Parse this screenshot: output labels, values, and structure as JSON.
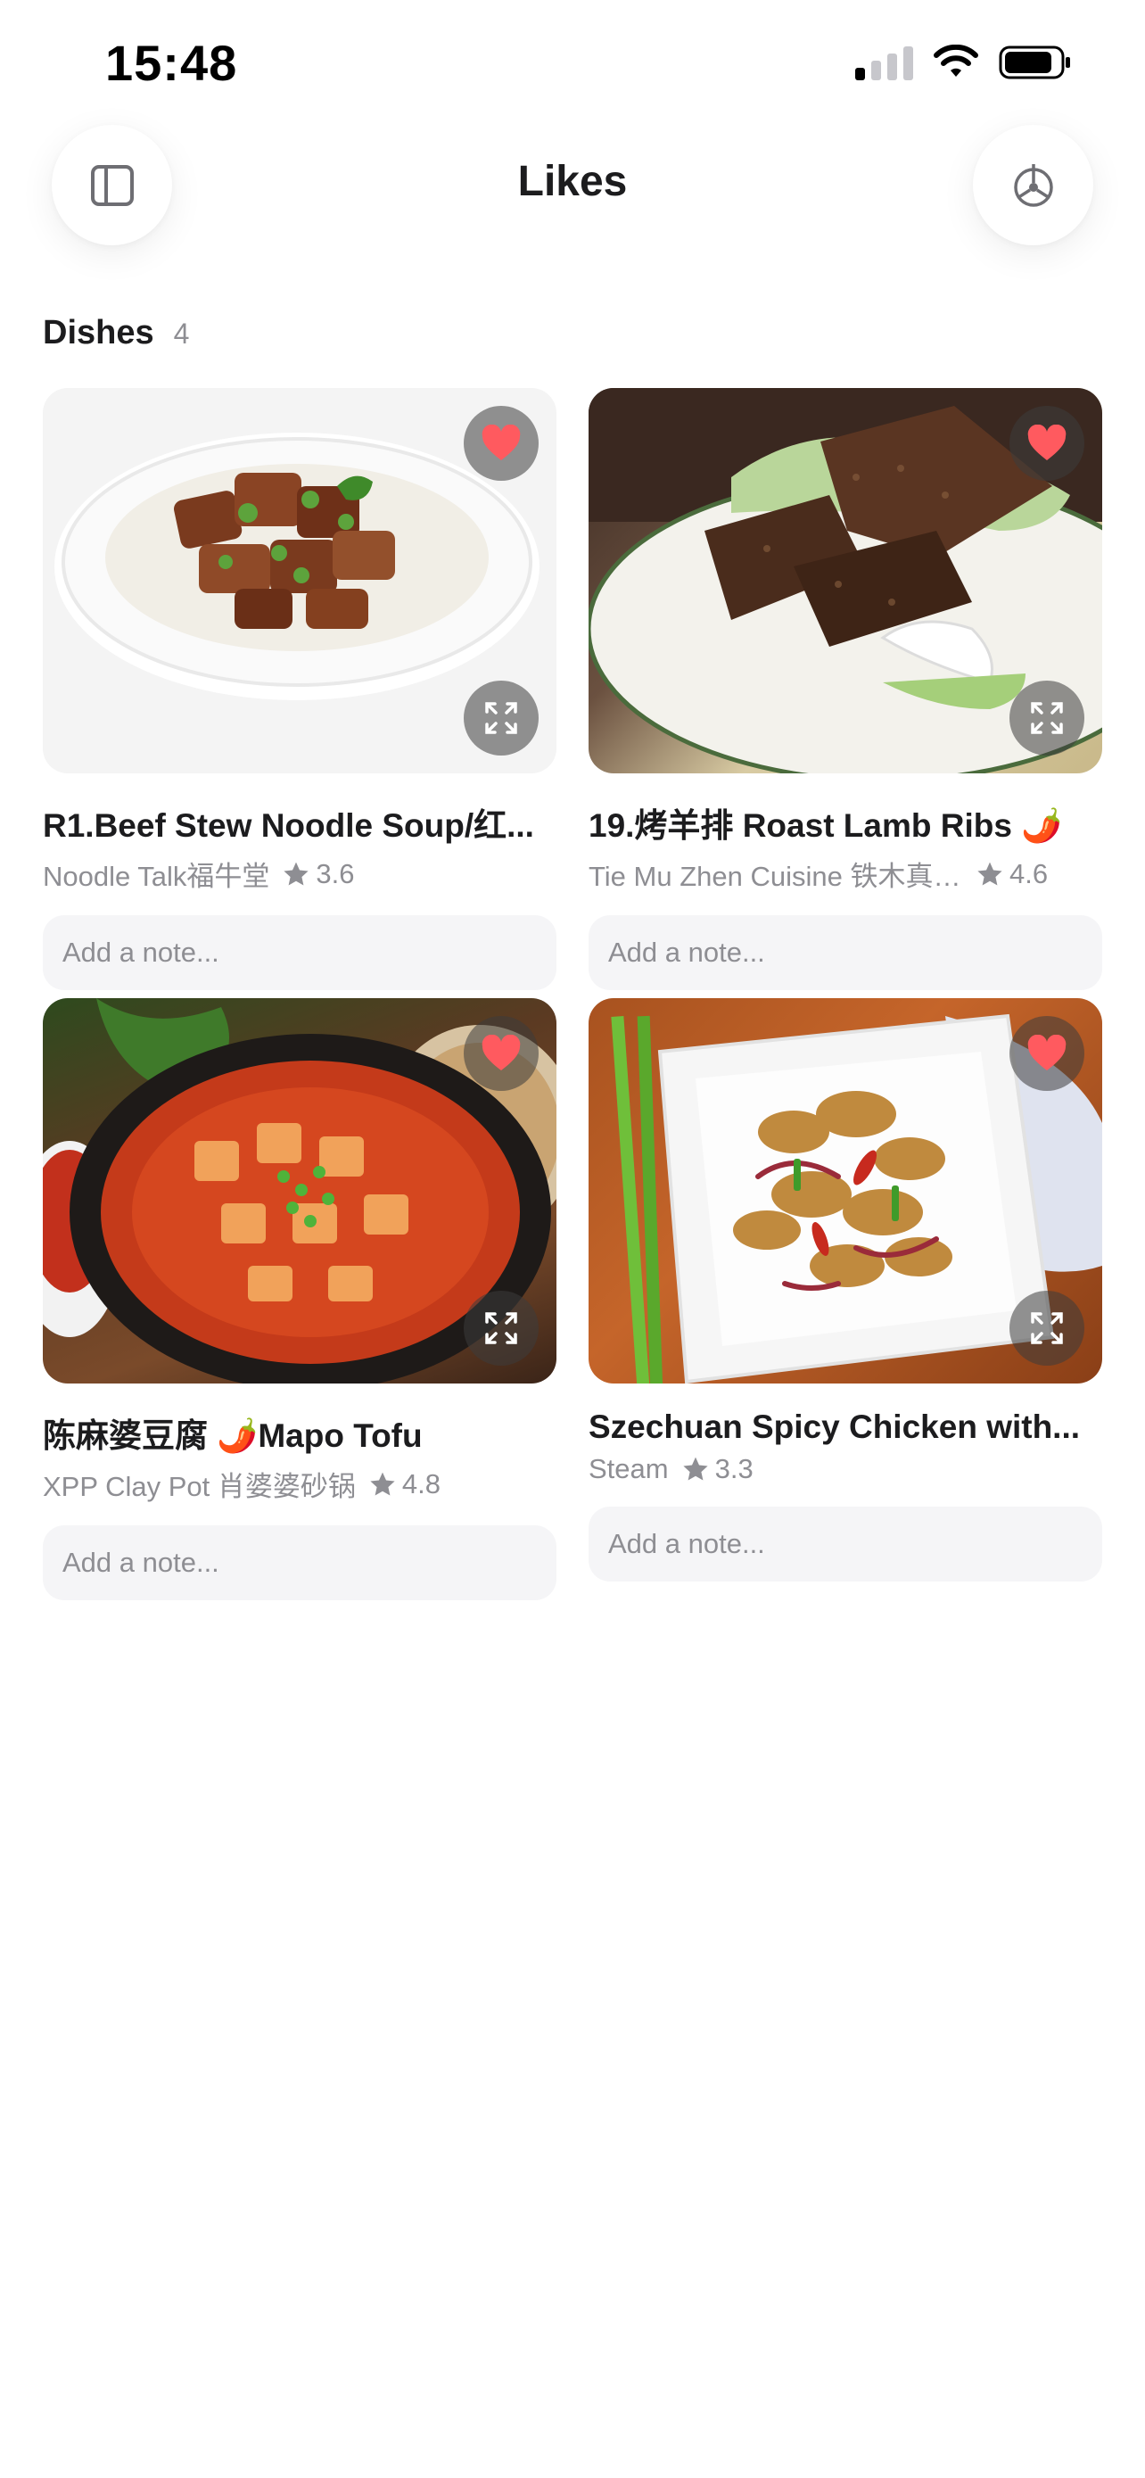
{
  "status_bar": {
    "time": "15:48"
  },
  "header": {
    "title": "Likes",
    "left_icon": "sidebar-icon",
    "right_icon": "compass-icon"
  },
  "section": {
    "title": "Dishes",
    "count": "4"
  },
  "dishes": [
    {
      "name": "R1.Beef Stew Noodle Soup/红...",
      "restaurant": "Noodle Talk福牛堂",
      "rating": "3.6",
      "note_placeholder": "Add a note..."
    },
    {
      "name": "19.烤羊排 Roast Lamb Ribs 🌶️",
      "restaurant": "Tie Mu Zhen Cuisine 铁木真内...",
      "rating": "4.6",
      "note_placeholder": "Add a note..."
    },
    {
      "name": "陈麻婆豆腐 🌶️Mapo Tofu",
      "restaurant": "XPP Clay Pot 肖婆婆砂锅",
      "rating": "4.8",
      "note_placeholder": "Add a note..."
    },
    {
      "name": "Szechuan Spicy Chicken with...",
      "restaurant": "Steam",
      "rating": "3.3",
      "note_placeholder": "Add a note..."
    }
  ],
  "colors": {
    "heart": "#ff5a5f",
    "accent_text": "#1c1c1e",
    "muted_text": "#8e8e93",
    "note_bg": "#f5f5f7"
  }
}
